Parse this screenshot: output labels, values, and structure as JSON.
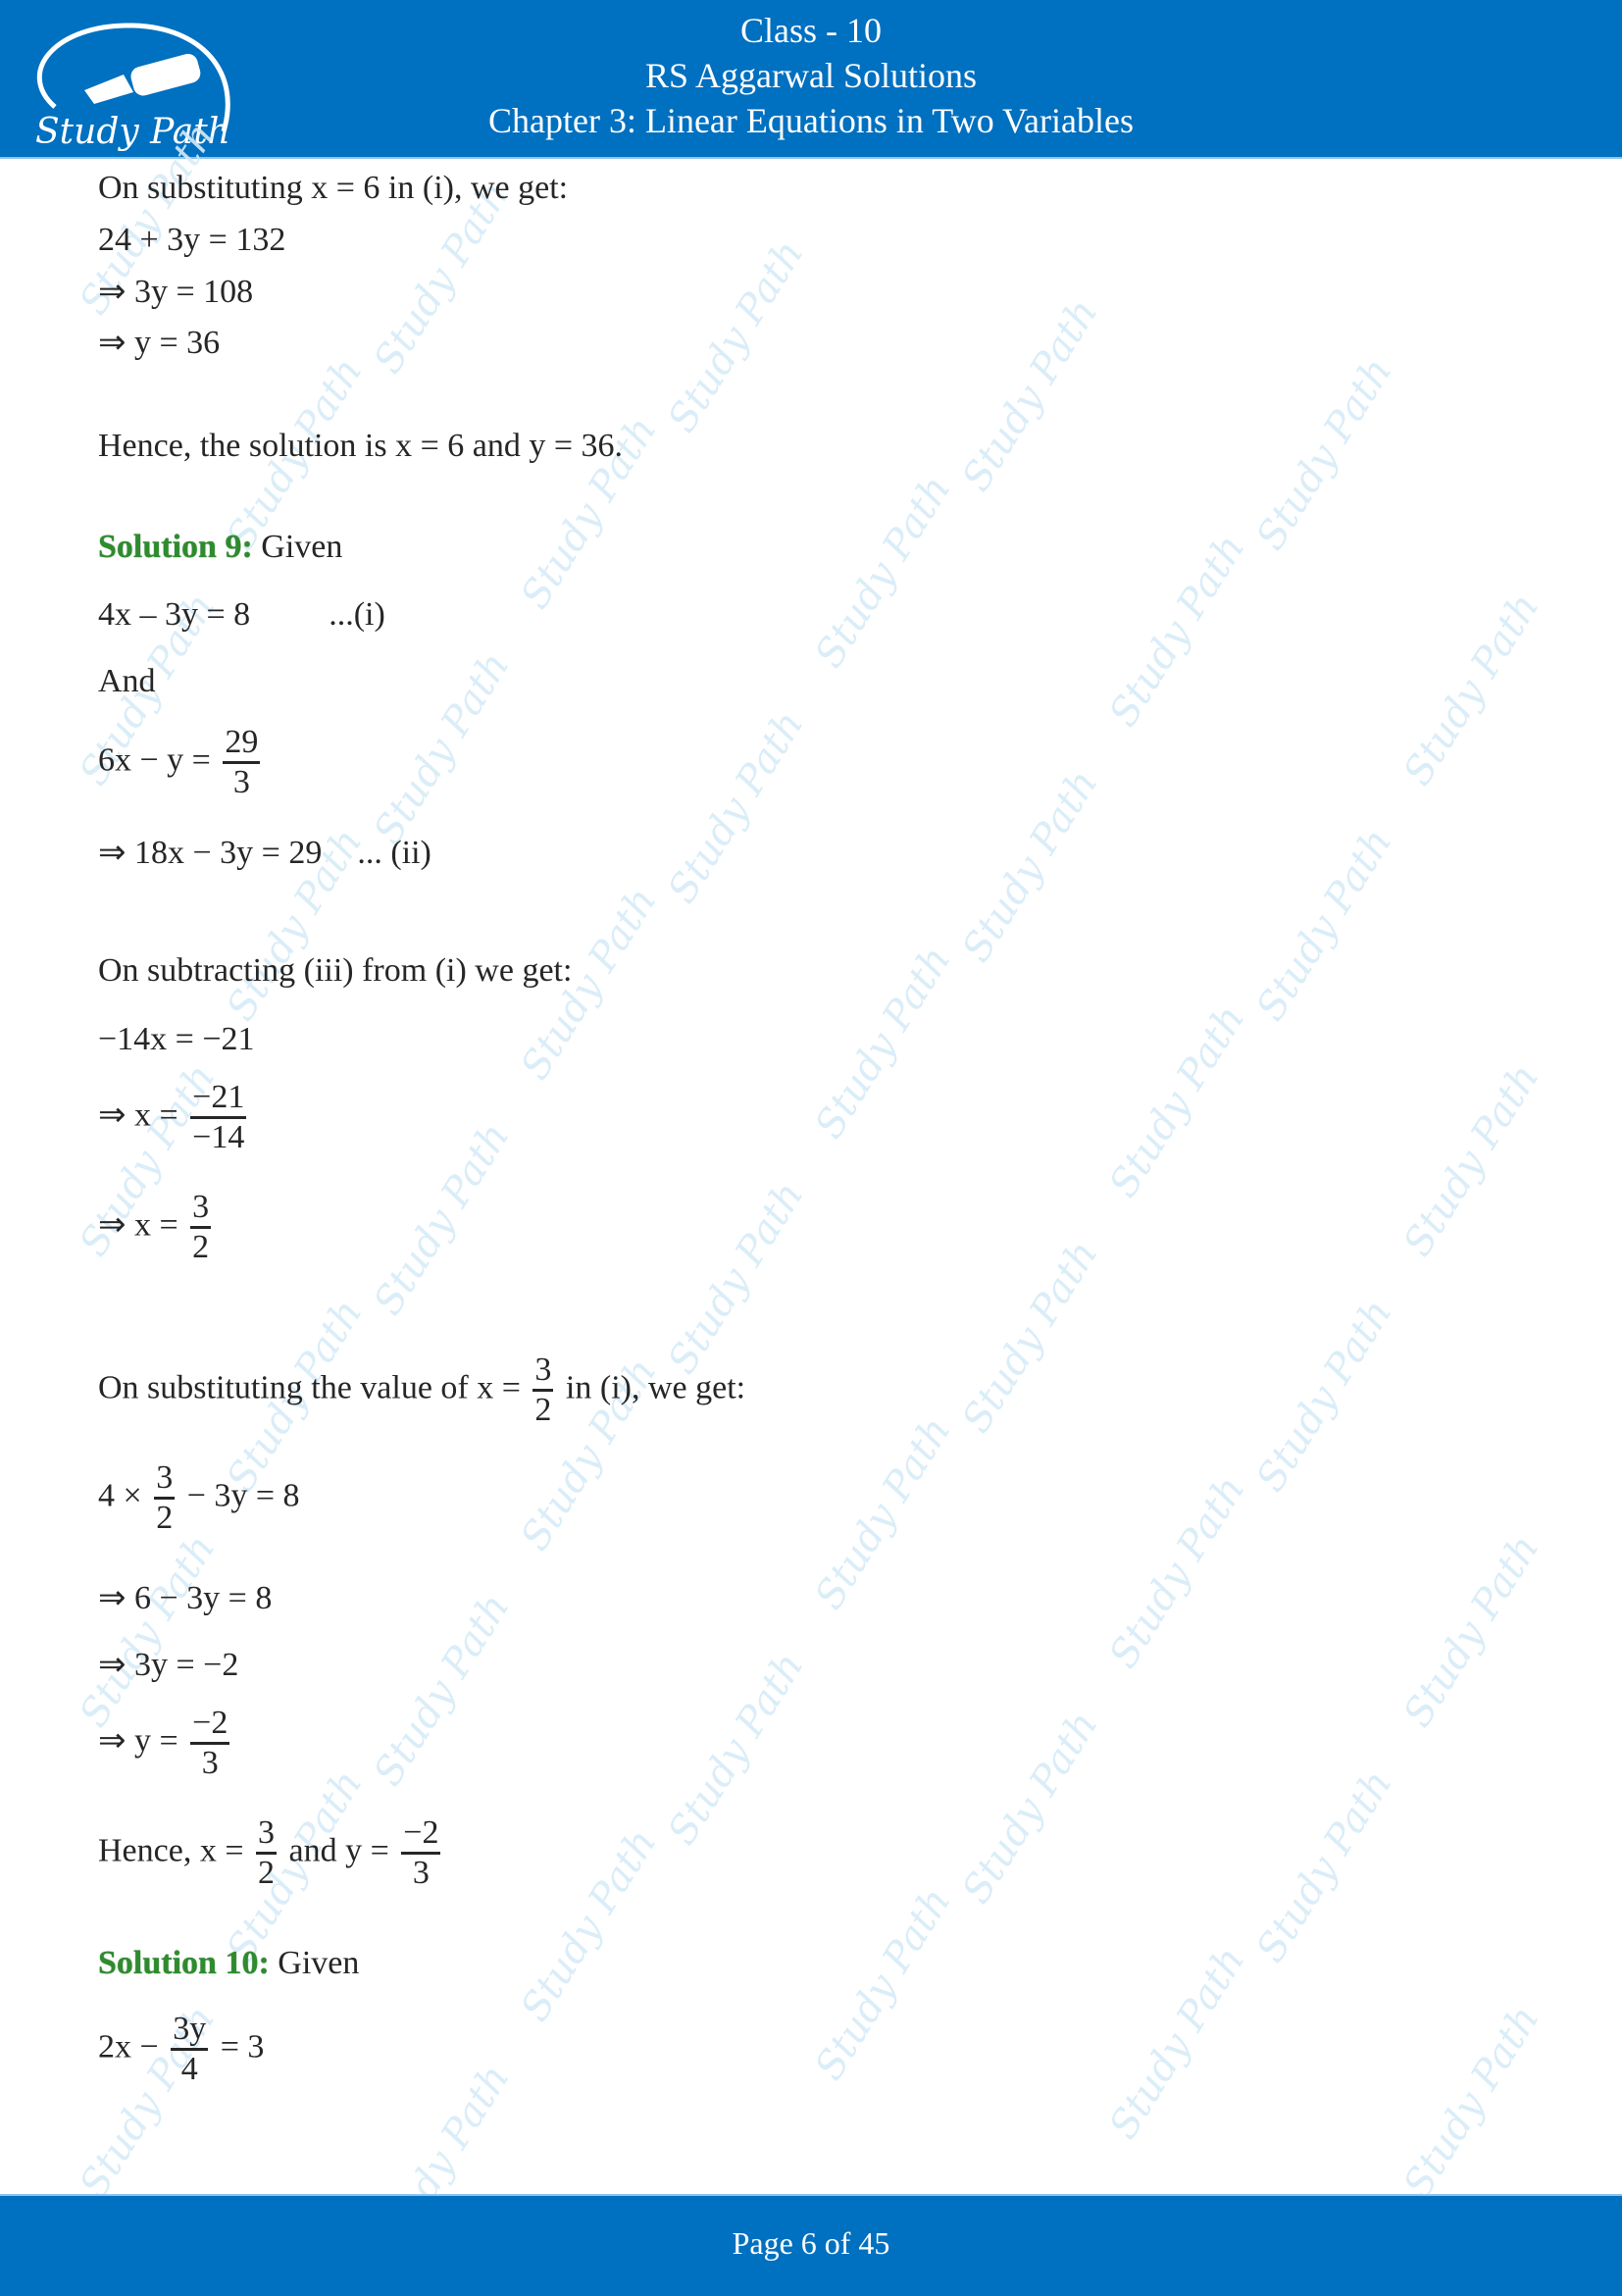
{
  "header": {
    "logo_text": "Study Path",
    "line1": "Class - 10",
    "line2": "RS Aggarwal Solutions",
    "line3": "Chapter 3: Linear Equations in Two Variables"
  },
  "footer": {
    "page_label": "Page 6 of 45"
  },
  "watermark_text": "Study Path",
  "content": {
    "l1": "On substituting x = 6 in (i), we get:",
    "l2": "24 + 3y = 132",
    "l3": "⇒ 3y = 108",
    "l4": "⇒ y = 36",
    "l5": "Hence, the solution is x = 6 and y = 36.",
    "sol9": {
      "label": "Solution 9:",
      "given": " Given"
    },
    "eq1": "4x – 3y = 8",
    "eq1_tag": "...(i)",
    "and": "And",
    "eq2_lhs": "6x − y =",
    "eq2_num": "29",
    "eq2_den": "3",
    "eq3": "⇒ 18x − 3y = 29",
    "eq3_tag": "... (ii)",
    "sub_text": "On subtracting (iii) from (i) we get:",
    "s1": "−14x = −21",
    "s2_lhs": "⇒ x =",
    "s2_num": "−21",
    "s2_den": "−14",
    "s3_lhs": "⇒ x =",
    "s3_num": "3",
    "s3_den": "2",
    "subst_pre": "On substituting the value of x =",
    "subst_num": "3",
    "subst_den": "2",
    "subst_post": "in (i), we get:",
    "t1_pre": "4 ×",
    "t1_num": "3",
    "t1_den": "2",
    "t1_post": "− 3y = 8",
    "t2": "⇒ 6 − 3y = 8",
    "t3": "⇒ 3y = −2",
    "t4_lhs": "⇒ y =",
    "t4_num": "−2",
    "t4_den": "3",
    "h_pre": "Hence, x =",
    "h_num1": "3",
    "h_den1": "2",
    "h_mid": "and y =",
    "h_num2": "−2",
    "h_den2": "3",
    "sol10": {
      "label": "Solution 10:",
      "given": " Given"
    },
    "u1_pre": "2x −",
    "u1_num": "3y",
    "u1_den": "4",
    "u1_post": "= 3"
  }
}
